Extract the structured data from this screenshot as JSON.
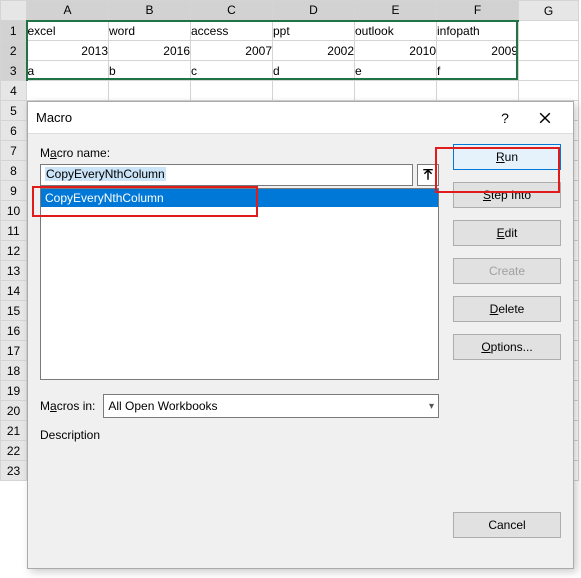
{
  "grid": {
    "cols": [
      "A",
      "B",
      "C",
      "D",
      "E",
      "F",
      "G"
    ],
    "rows": [
      "1",
      "2",
      "3",
      "4",
      "5",
      "6",
      "7",
      "8",
      "9",
      "10",
      "11",
      "12",
      "13",
      "14",
      "15",
      "16",
      "17",
      "18",
      "19",
      "20",
      "21",
      "22",
      "23"
    ],
    "data": {
      "r1": {
        "A": "excel",
        "B": "word",
        "C": "access",
        "D": "ppt",
        "E": "outlook",
        "F": "infopath"
      },
      "r2": {
        "A": "2013",
        "B": "2016",
        "C": "2007",
        "D": "2002",
        "E": "2010",
        "F": "2009"
      },
      "r3": {
        "A": "a",
        "B": "b",
        "C": "c",
        "D": "d",
        "E": "e",
        "F": "f"
      }
    }
  },
  "dialog": {
    "title": "Macro",
    "help": "?",
    "name_label_pre": "M",
    "name_label_und": "a",
    "name_label_post": "cro name:",
    "name_value": "CopyEveryNthColumn",
    "list": {
      "items": [
        "CopyEveryNthColumn"
      ],
      "selected": 0
    },
    "macros_in_pre": "M",
    "macros_in_und": "a",
    "macros_in_post": "cros in:",
    "macros_in_value": "All Open Workbooks",
    "description_label": "Description",
    "buttons": {
      "run_und": "R",
      "run_post": "un",
      "step_und": "S",
      "step_post": "tep Into",
      "edit_und": "E",
      "edit_post": "dit",
      "create": "Create",
      "delete_und": "D",
      "delete_post": "elete",
      "options_und": "O",
      "options_post": "ptions...",
      "cancel": "Cancel"
    }
  }
}
